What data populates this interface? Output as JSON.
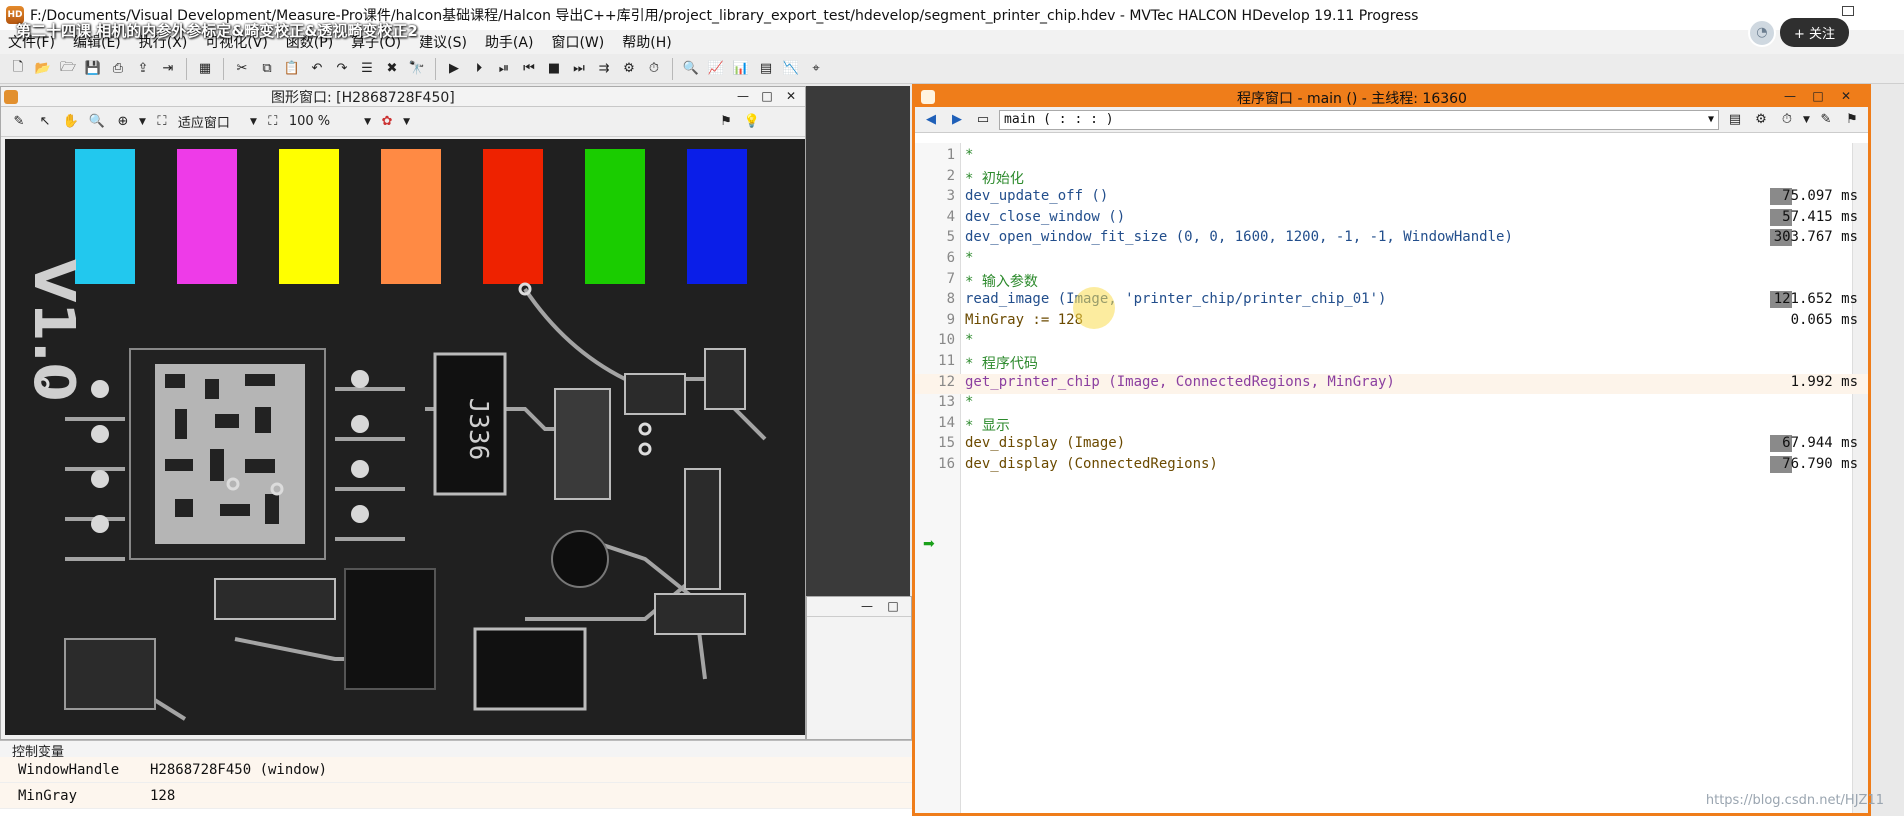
{
  "window": {
    "title": "F:/Documents/Visual Development/Measure-Pro课件/halcon基础课程/Halcon 导出C++库引用/project_library_export_test/hdevelop/segment_printer_chip.hdev - MVTec HALCON HDevelop 19.11 Progress",
    "app_icon_text": "HD"
  },
  "overlay": {
    "video_title": "第二十四课 相机的内参外参标定&畸变校正&透视畸变校正2",
    "follow_label": "+ 关注"
  },
  "menu": [
    "文件(F)",
    "编辑(E)",
    "执行(X)",
    "可视化(V)",
    "函数(P)",
    "算子(O)",
    "建议(S)",
    "助手(A)",
    "窗口(W)",
    "帮助(H)"
  ],
  "graphics_window": {
    "title": "图形窗口: [H2868728F450]",
    "fit_label": "适应窗口",
    "zoom_label": "100 %"
  },
  "chip_colors": [
    "#22c8ee",
    "#ee3be8",
    "#ffff00",
    "#ff8a44",
    "#ee2200",
    "#1acc00",
    "#0a1ee8"
  ],
  "pcb_label": "V1.0",
  "chip_label": "J336",
  "variable_window": {
    "title": "控制变量",
    "rows": [
      {
        "name": "WindowHandle",
        "value": "H2868728F450 (window)"
      },
      {
        "name": "MinGray",
        "value": "128"
      }
    ]
  },
  "program_window": {
    "title": "程序窗口 - main () - 主线程: 16360",
    "procedure": "main ( : : : )",
    "lines": [
      {
        "no": "1",
        "text": "*",
        "kind": "comment",
        "time": ""
      },
      {
        "no": "2",
        "text": "* 初始化",
        "kind": "comment",
        "time": ""
      },
      {
        "no": "3",
        "text": "dev_update_off ()",
        "kind": "op",
        "time": "75.097 ms",
        "bar": true
      },
      {
        "no": "4",
        "text": "dev_close_window ()",
        "kind": "op",
        "time": "57.415 ms",
        "bar": true
      },
      {
        "no": "5",
        "text": "dev_open_window_fit_size (0, 0, 1600, 1200, -1, -1, WindowHandle)",
        "kind": "op",
        "time": "303.767 ms",
        "bar": true
      },
      {
        "no": "6",
        "text": "*",
        "kind": "comment",
        "time": ""
      },
      {
        "no": "7",
        "text": "* 输入参数",
        "kind": "comment",
        "time": ""
      },
      {
        "no": "8",
        "text": "read_image (Image, 'printer_chip/printer_chip_01')",
        "kind": "op",
        "time": "121.652 ms",
        "bar": true
      },
      {
        "no": "9",
        "text": "MinGray := 128",
        "kind": "assign",
        "time": "0.065 ms"
      },
      {
        "no": "10",
        "text": "*",
        "kind": "comment",
        "time": ""
      },
      {
        "no": "11",
        "text": "* 程序代码",
        "kind": "comment",
        "time": ""
      },
      {
        "no": "12",
        "text": "get_printer_chip (Image, ConnectedRegions, MinGray)",
        "kind": "proc",
        "time": "1.992 ms",
        "highlight": true
      },
      {
        "no": "13",
        "text": "*",
        "kind": "comment",
        "time": ""
      },
      {
        "no": "14",
        "text": "* 显示",
        "kind": "comment",
        "time": ""
      },
      {
        "no": "15",
        "text": "dev_display (Image)",
        "kind": "assign",
        "time": "67.944 ms",
        "bar": true
      },
      {
        "no": "16",
        "text": "dev_display (ConnectedRegions)",
        "kind": "assign",
        "time": "76.790 ms",
        "bar": true
      }
    ]
  },
  "watermark": "https://blog.csdn.net/HJZ11"
}
